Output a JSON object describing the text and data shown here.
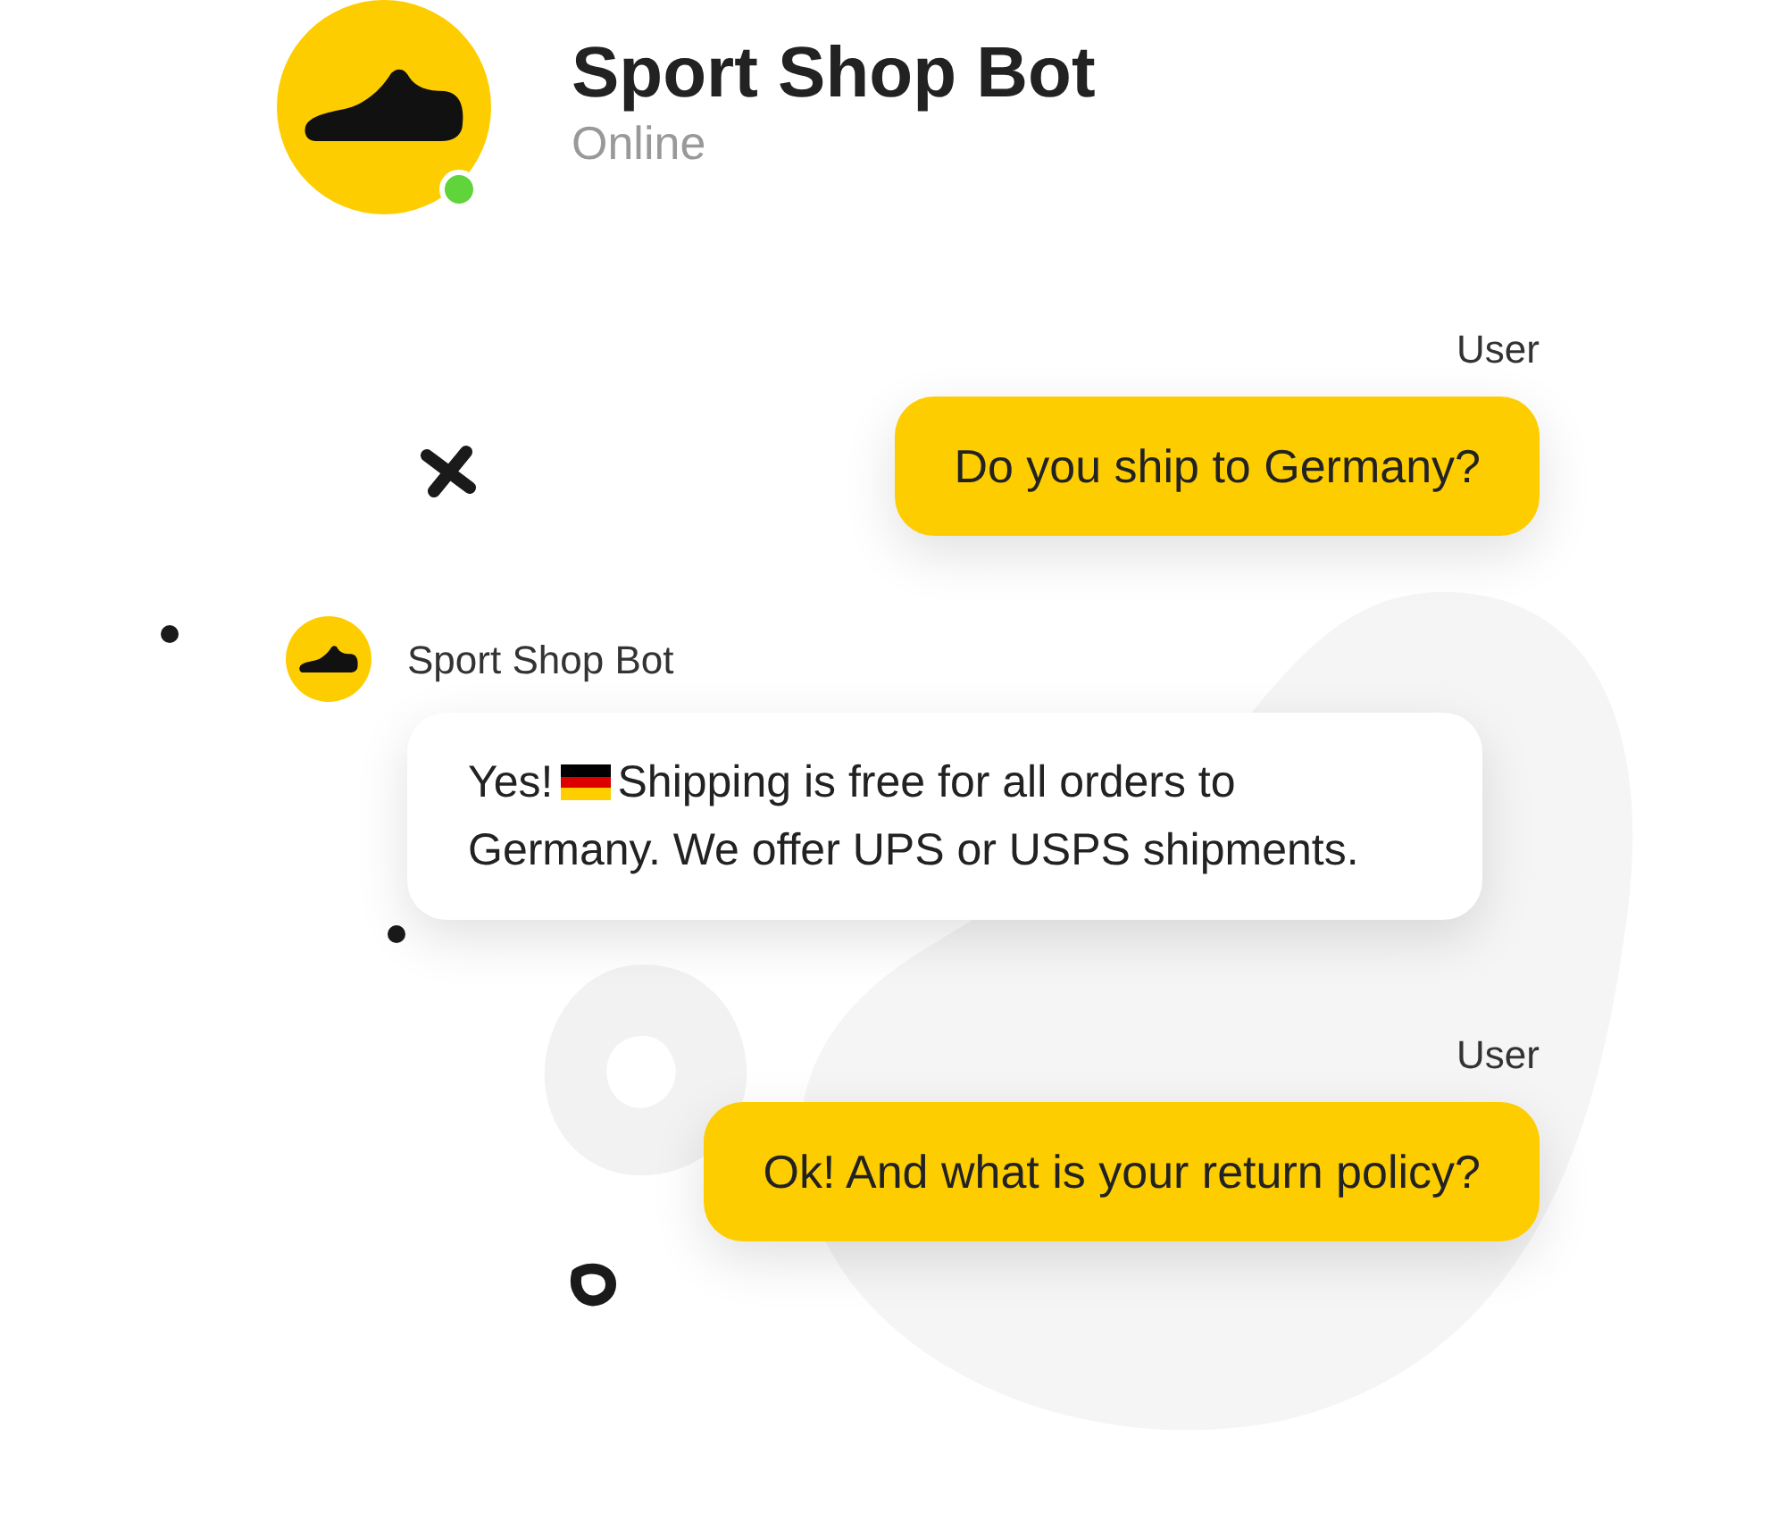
{
  "bot": {
    "name": "Sport Shop Bot",
    "status": "Online",
    "online": true
  },
  "messages": [
    {
      "kind": "user",
      "author": "User",
      "text": "Do you ship to Germany?"
    },
    {
      "kind": "bot",
      "author": "Sport Shop Bot",
      "lead": "Yes!",
      "text": "Shipping is free for all orders to Germany. We offer UPS or USPS shipments."
    },
    {
      "kind": "user",
      "author": "User",
      "text": "Ok! And what is your return policy?"
    }
  ]
}
